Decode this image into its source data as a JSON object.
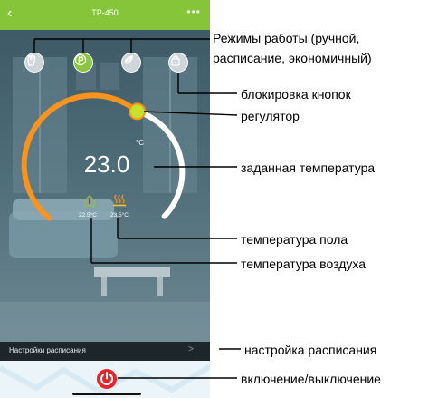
{
  "app": {
    "title": "TP-450",
    "back_icon": "back-chevron-icon",
    "more_icon": "more-dots-icon"
  },
  "modes": [
    {
      "name": "manual",
      "icon": "hand-icon",
      "active": false
    },
    {
      "name": "schedule",
      "icon": "p-program-icon",
      "active": true
    },
    {
      "name": "eco",
      "icon": "leaf-icon",
      "active": false
    }
  ],
  "lock": {
    "icon": "lock-icon"
  },
  "thermostat": {
    "set_temperature": "23.0",
    "unit": "°C",
    "floor_temperature": "23.5°C",
    "air_temperature": "22.5°C"
  },
  "schedule_bar": {
    "label": "Настройки расписания",
    "chevron": ">"
  },
  "power": {
    "icon": "power-icon"
  },
  "colors": {
    "accent": "#86c53a",
    "arc": "#f7931e",
    "knob": "#c5e12c",
    "power": "#e8232a"
  },
  "callouts": {
    "modes_line1": "Режимы работы (ручной,",
    "modes_line2": "расписание, экономичный)",
    "lock": "блокировка кнопок",
    "regulator": "регулятор",
    "set_temp": "заданная температура",
    "floor_temp": "температура пола",
    "air_temp": "температура воздуха",
    "schedule": "настройка расписания",
    "power": "включение/выключение"
  }
}
